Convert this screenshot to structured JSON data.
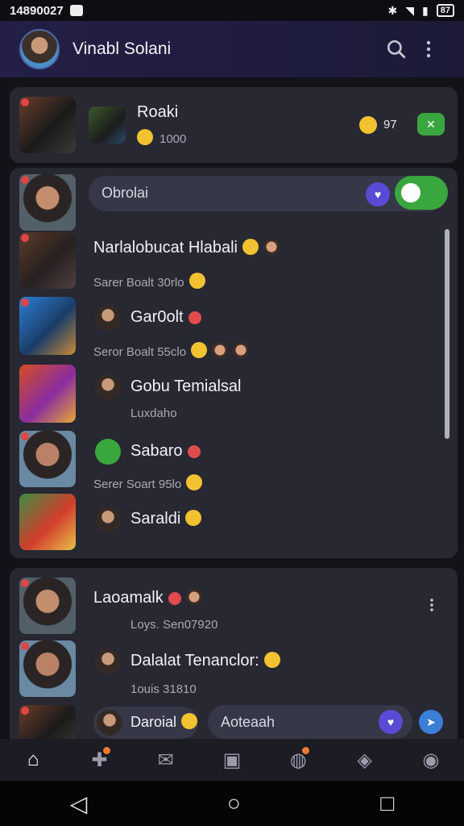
{
  "status": {
    "time": "14890027",
    "icons": [
      "sim-icon",
      "bluetooth-icon",
      "wifi-icon",
      "battery-icon"
    ],
    "battery": "87"
  },
  "header": {
    "title": "Vinabl Solani",
    "avatar": "profile-avatar",
    "icons": [
      "search-icon",
      "more-vert-icon"
    ]
  },
  "cards": {
    "top": {
      "title": "Roaki",
      "subtitle": "1000",
      "count": "97",
      "action_icon": "x-icon"
    },
    "main": {
      "input_placeholder": "Obrolai",
      "items": [
        {
          "title": "Narlalobucat Hlabali",
          "subtitle": "Sarer Boalt 30rlo"
        },
        {
          "title": "Gar0olt",
          "subtitle": "Seror Boalt 55clo"
        },
        {
          "title": "Gobu Temialsal",
          "subtitle": "Luxdaho"
        },
        {
          "title": "Sabaro",
          "subtitle": "Serer Soart 95lo"
        },
        {
          "title": "Saraldi",
          "subtitle": ""
        }
      ]
    },
    "bottom": {
      "items": [
        {
          "title": "Laoamalk",
          "subtitle": "Loys. Sen07920"
        },
        {
          "title": "Dalalat Tenanclor:",
          "subtitle": "1ouis 31810"
        },
        {
          "title": "Daroial",
          "subtitle": ""
        }
      ],
      "reply_placeholder": "Aoteaah"
    }
  },
  "bottom_nav": {
    "items": [
      "home-icon",
      "puzzle-icon",
      "mail-icon",
      "game-icon",
      "shield-icon",
      "badge-icon",
      "controller-icon"
    ]
  },
  "system_nav": {
    "items": [
      "back-icon",
      "home-circle-icon",
      "recents-icon"
    ]
  },
  "colors": {
    "accent": "#5a4bd6",
    "green": "#3aa63e",
    "bg": "#121218",
    "card": "#272832",
    "header": "#231f46"
  }
}
